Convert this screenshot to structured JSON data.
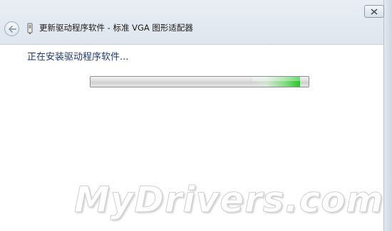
{
  "window": {
    "title": "更新驱动程序软件 - 标准 VGA 图形适配器"
  },
  "toolbar": {
    "back_icon": "back-arrow-icon",
    "close_icon": "close-icon",
    "device_icon": "device-icon"
  },
  "content": {
    "status_text": "正在安装驱动程序软件...",
    "progress": {
      "state": "indeterminate",
      "glow_position_fraction": 0.85,
      "glow_color": "#26c626"
    }
  },
  "watermark": {
    "text": "MyDrivers.com"
  }
}
